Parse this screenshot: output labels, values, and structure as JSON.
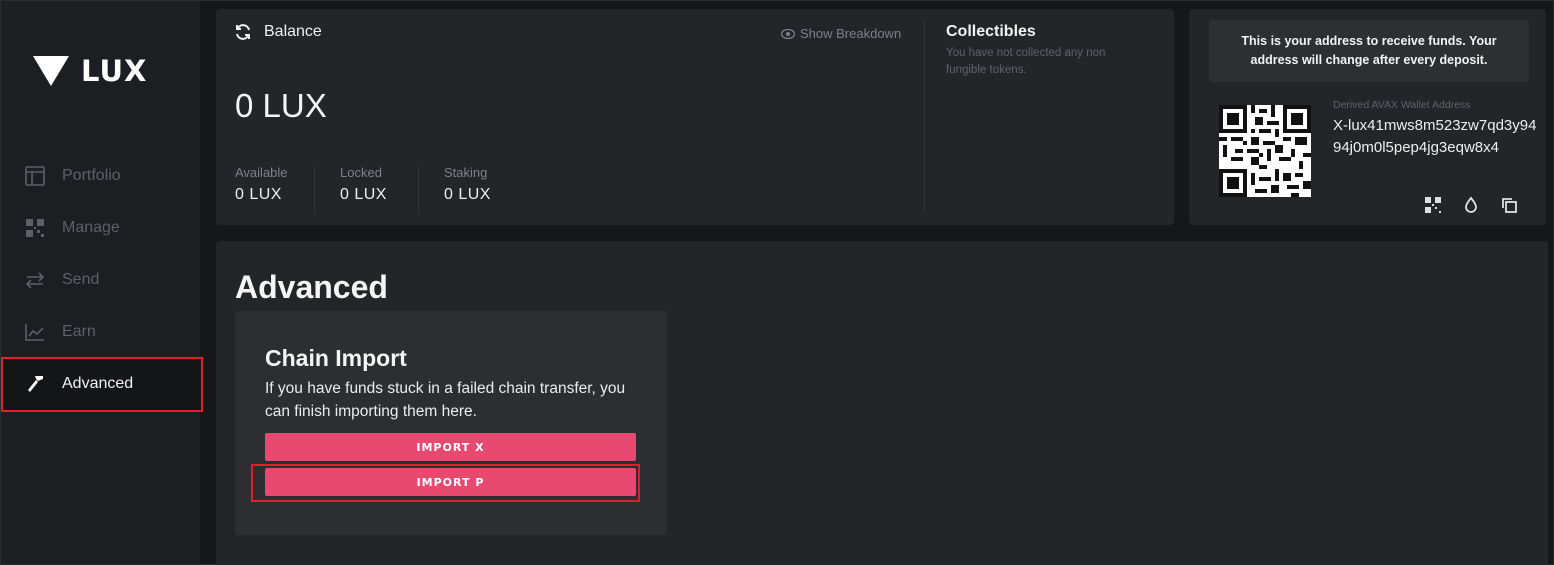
{
  "brand": {
    "name": "LUX"
  },
  "sidebar": {
    "items": [
      {
        "label": "Portfolio",
        "icon": "portfolio-icon"
      },
      {
        "label": "Manage",
        "icon": "qr-grid-icon"
      },
      {
        "label": "Send",
        "icon": "transfer-arrows-icon"
      },
      {
        "label": "Earn",
        "icon": "chart-icon"
      },
      {
        "label": "Advanced",
        "icon": "hammer-icon",
        "active": true
      }
    ]
  },
  "balance": {
    "title": "Balance",
    "show_breakdown": "Show Breakdown",
    "total": "0 LUX",
    "available_label": "Available",
    "available_value": "0 LUX",
    "locked_label": "Locked",
    "locked_value": "0 LUX",
    "staking_label": "Staking",
    "staking_value": "0 LUX"
  },
  "collectibles": {
    "title": "Collectibles",
    "empty_text": "You have not collected any non fungible tokens."
  },
  "address": {
    "note": "This is your address to receive funds. Your address will change after every deposit.",
    "label": "Derived AVAX Wallet Address",
    "value": "X-lux41mws8m523zw7qd3y9494j0m0l5pep4jg3eqw8x4"
  },
  "main": {
    "title": "Advanced",
    "chain_import": {
      "title": "Chain Import",
      "description": "If you have funds stuck in a failed chain transfer, you can finish importing them here.",
      "import_x_label": "IMPORT X",
      "import_p_label": "IMPORT P"
    }
  },
  "colors": {
    "accent": "#e84970",
    "highlight": "#e01f2d",
    "background": "#151719",
    "card": "#232528"
  }
}
